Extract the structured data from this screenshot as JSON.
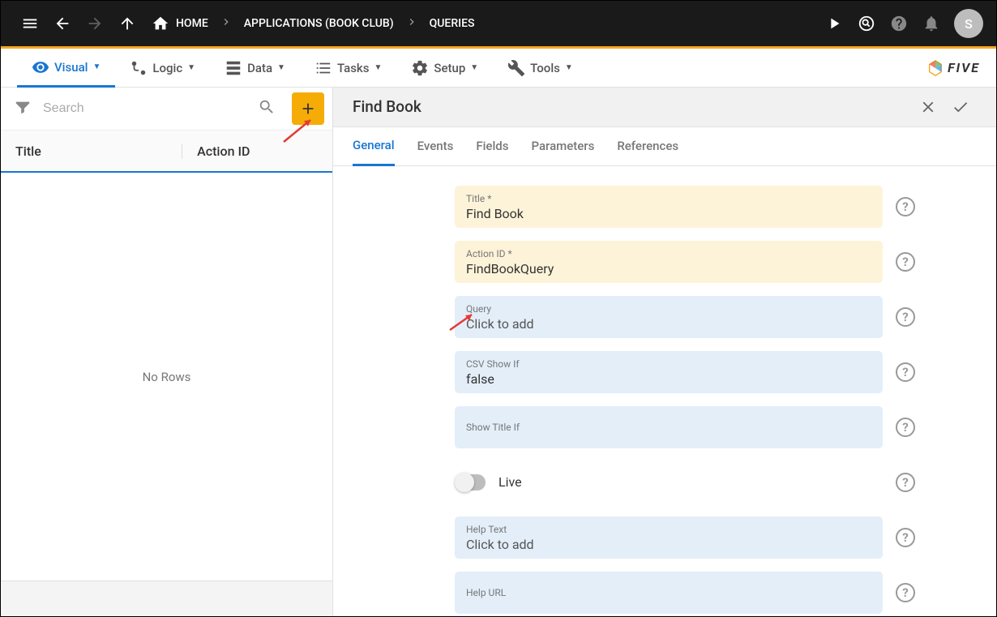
{
  "topbar": {
    "home_label": "HOME",
    "crumb1": "APPLICATIONS (BOOK CLUB)",
    "crumb2": "QUERIES",
    "avatar_initial": "S"
  },
  "subnav": {
    "items": [
      {
        "label": "Visual",
        "active": true
      },
      {
        "label": "Logic"
      },
      {
        "label": "Data"
      },
      {
        "label": "Tasks"
      },
      {
        "label": "Setup"
      },
      {
        "label": "Tools"
      }
    ],
    "logo": "FIVE"
  },
  "left": {
    "search_placeholder": "Search",
    "col1": "Title",
    "col2": "Action ID",
    "empty_text": "No Rows"
  },
  "right": {
    "header_title": "Find Book",
    "tabs": [
      "General",
      "Events",
      "Fields",
      "Parameters",
      "References"
    ],
    "active_tab": 0,
    "fields": {
      "title_label": "Title *",
      "title_value": "Find Book",
      "actionid_label": "Action ID *",
      "actionid_value": "FindBookQuery",
      "query_label": "Query",
      "query_value": "Click to add",
      "csv_label": "CSV Show If",
      "csv_value": "false",
      "showtitle_label": "Show Title If",
      "showtitle_value": "",
      "live_label": "Live",
      "helptext_label": "Help Text",
      "helptext_value": "Click to add",
      "helpurl_label": "Help URL",
      "helpurl_value": ""
    }
  }
}
